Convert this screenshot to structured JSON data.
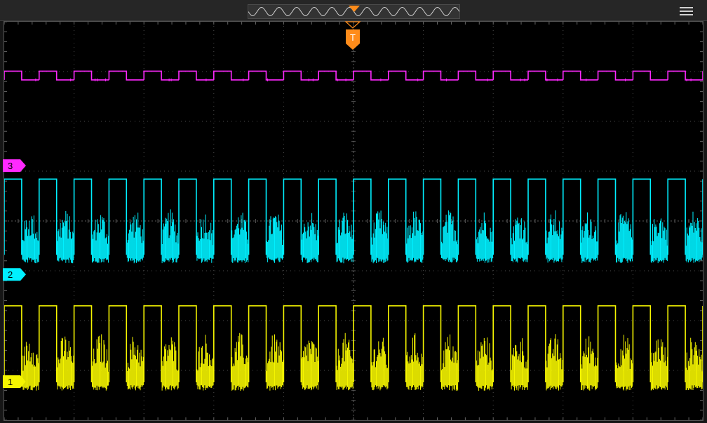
{
  "menu": {
    "icon": "hamburger-menu-icon"
  },
  "trigger": {
    "label": "T",
    "color": "#ff8c1a"
  },
  "channels": [
    {
      "id": 1,
      "label": "1",
      "color": "#f5f500",
      "marker_level": 0.905,
      "high": 0.713,
      "low": 0.905,
      "noisy": true,
      "noise_top": 0.78
    },
    {
      "id": 2,
      "label": "2",
      "color": "#00f0ff",
      "marker_level": 0.636,
      "high": 0.395,
      "low": 0.585,
      "noisy": true,
      "noise_top": 0.47
    },
    {
      "id": 3,
      "label": "3",
      "color": "#ff29ff",
      "marker_level": 0.363,
      "high": 0.124,
      "low": 0.146,
      "noisy": false
    }
  ],
  "signal": {
    "period_divs": 0.5,
    "duty": 0.5,
    "phase": 0.0
  },
  "grid": {
    "h_divs": 10,
    "v_divs": 8,
    "color": "#4a4a4a"
  }
}
